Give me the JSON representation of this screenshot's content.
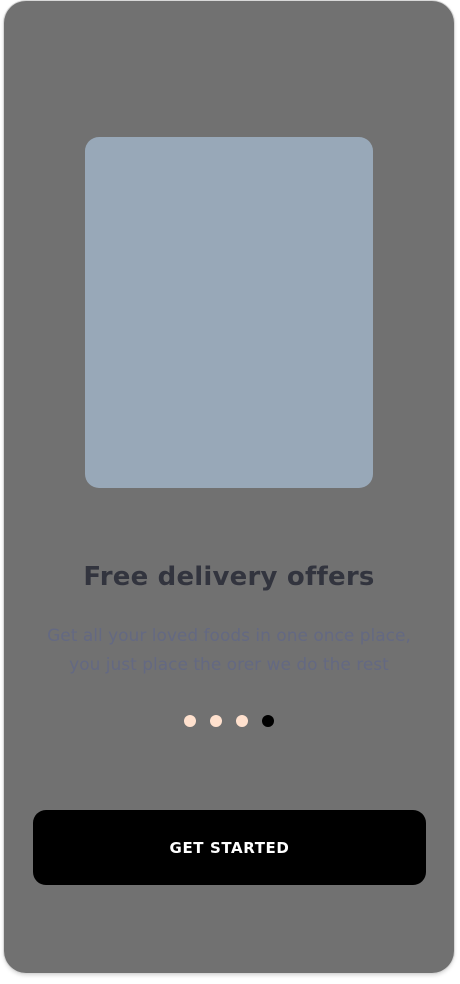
{
  "onboarding": {
    "title": "Free delivery offers",
    "subtitle_line1": "Get all your loved foods in one once place,",
    "subtitle_line2": "you just place the orer we do the rest",
    "page_indicator": {
      "total": 4,
      "current": 4
    },
    "cta_label": "GET STARTED"
  },
  "colors": {
    "overlay_background": "#717171",
    "image_placeholder": "#98a8b8",
    "dot_inactive": "#ffe1ce",
    "dot_active": "#000000",
    "button_background": "#000000",
    "button_text": "#ffffff"
  }
}
